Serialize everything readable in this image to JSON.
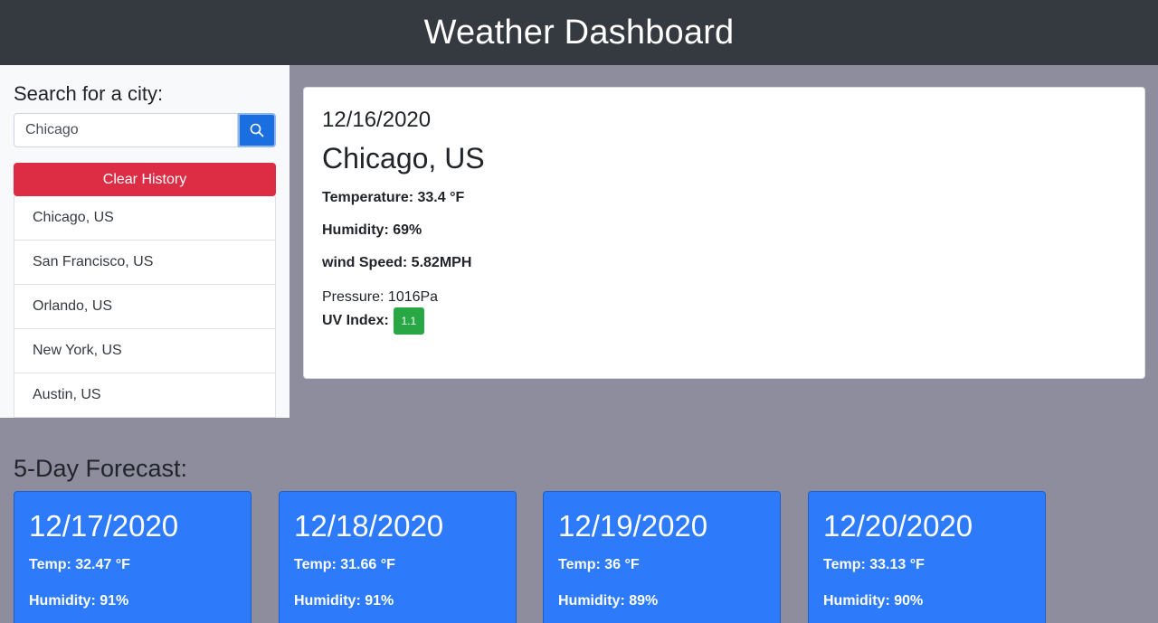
{
  "header": {
    "title": "Weather Dashboard"
  },
  "sidebar": {
    "search_label": "Search for a city:",
    "search_value": "Chicago",
    "search_button_icon": "search-icon",
    "clear_label": "Clear History",
    "history": [
      "Chicago, US",
      "San Francisco, US",
      "Orlando, US",
      "New York, US",
      "Austin, US"
    ]
  },
  "current": {
    "date": "12/16/2020",
    "city": "Chicago, US",
    "temperature": "Temperature: 33.4 °F",
    "humidity": "Humidity: 69%",
    "wind": "wind Speed: 5.82MPH",
    "pressure": "Pressure: 1016Pa",
    "uv_label": "UV Index:",
    "uv_value": "1.1",
    "uv_color": "#28a745"
  },
  "forecast": {
    "title": "5-Day Forecast:",
    "days": [
      {
        "date": "12/17/2020",
        "temp": "Temp: 32.47 °F",
        "humidity": "Humidity: 91%"
      },
      {
        "date": "12/18/2020",
        "temp": "Temp: 31.66 °F",
        "humidity": "Humidity: 91%"
      },
      {
        "date": "12/19/2020",
        "temp": "Temp: 36 °F",
        "humidity": "Humidity: 89%"
      },
      {
        "date": "12/20/2020",
        "temp": "Temp: 33.13 °F",
        "humidity": "Humidity: 90%"
      }
    ]
  },
  "colors": {
    "header_bg": "#343a40",
    "page_bg": "#8e8d9e",
    "primary": "#1b6ee0",
    "danger": "#dc2d45",
    "forecast_card": "#2d7bfb"
  }
}
